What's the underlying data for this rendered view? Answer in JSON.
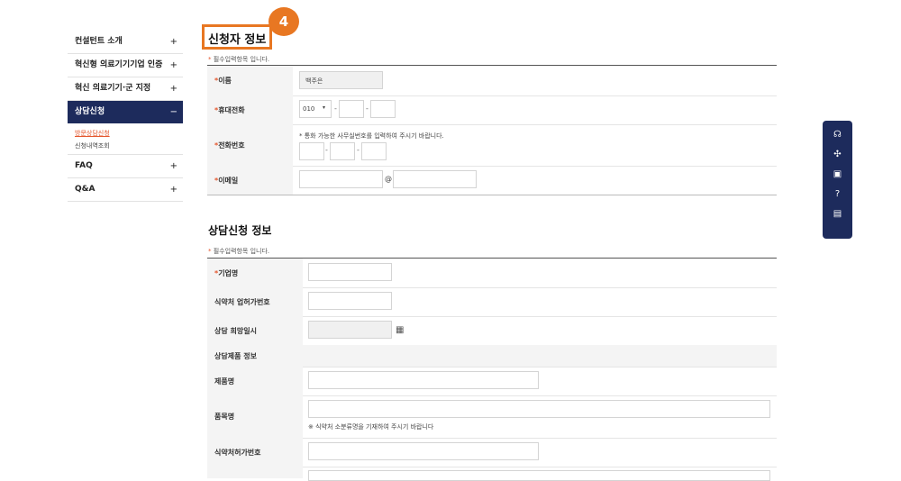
{
  "sidebar": {
    "items": [
      {
        "label": "컨설턴트 소개",
        "toggle": "+"
      },
      {
        "label": "혁신형 의료기기기업 인증",
        "toggle": "+"
      },
      {
        "label": "혁신 의료기기·군 지정",
        "toggle": "+"
      },
      {
        "label": "상담신청",
        "toggle": "−"
      },
      {
        "label": "FAQ",
        "toggle": "+"
      },
      {
        "label": "Q&A",
        "toggle": "+"
      }
    ],
    "sub_items": [
      "방문상담신청",
      "신청내역조회"
    ]
  },
  "annotation": {
    "step_number": "4"
  },
  "applicant": {
    "title": "신청자 정보",
    "required_note": "필수입력항목 입니다.",
    "name_label": "이름",
    "name_value": "백주은",
    "mobile_label": "휴대전화",
    "mobile_prefix": "010",
    "phone_label": "전화번호",
    "phone_note": "* 통화 가능한 사무실번호를 입력하여 주시기 바랍니다.",
    "email_label": "이메일",
    "at_sign": "@"
  },
  "consult": {
    "title": "상담신청 정보",
    "required_note": "필수입력항목 입니다.",
    "company_label": "기업명",
    "license_label": "식약처 업허가번호",
    "date_label": "상담 희망일시",
    "product_info_label": "상담제품 정보",
    "product_name_label": "제품명",
    "item_name_label": "품목명",
    "item_name_note": "※ 식약처 소분류명을 기재하여 주시기 바랍니다",
    "approval_label": "식약처허가번호"
  },
  "colors": {
    "navy": "#1d2b5c",
    "accent_orange": "#e87722",
    "required_red": "#e4572e"
  },
  "floating_bar": {
    "icons": [
      "headset-icon",
      "network-icon",
      "calendar-icon",
      "question-icon",
      "chat-icon"
    ]
  }
}
